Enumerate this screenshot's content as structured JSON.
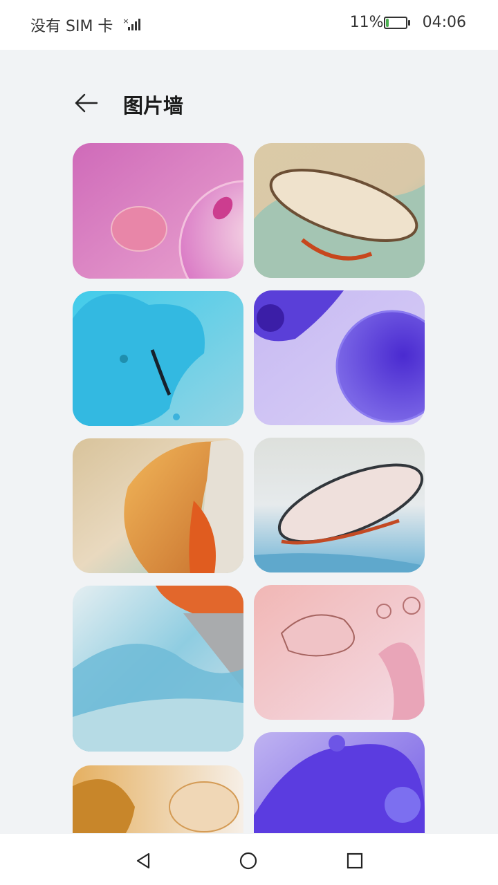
{
  "status_bar": {
    "sim_text": "没有 SIM 卡",
    "signal_x": "×",
    "battery_text": "11%",
    "battery_level": 0.11,
    "time": "04:06"
  },
  "header": {
    "title": "图片墙",
    "back_icon": "arrow-left-icon"
  },
  "gallery": {
    "images": [
      {
        "column": "left",
        "desc_icon": "image",
        "colors": [
          "#d36cc0",
          "#e7a7d5"
        ]
      },
      {
        "column": "right",
        "desc_icon": "image",
        "colors": [
          "#d6c7a3",
          "#a7c4b4"
        ]
      },
      {
        "column": "left",
        "desc_icon": "image",
        "colors": [
          "#3fc7e8",
          "#93d6e6"
        ]
      },
      {
        "column": "right",
        "desc_icon": "image",
        "colors": [
          "#6b4be0",
          "#c9bdf5"
        ]
      },
      {
        "column": "left",
        "desc_icon": "image",
        "colors": [
          "#e0a247",
          "#a9cfc6"
        ]
      },
      {
        "column": "right",
        "desc_icon": "image",
        "colors": [
          "#dde2e5",
          "#6db1d3"
        ]
      },
      {
        "column": "left",
        "desc_icon": "image",
        "colors": [
          "#8cc9dc",
          "#d8e5ea"
        ]
      },
      {
        "column": "right",
        "desc_icon": "image",
        "colors": [
          "#f2b9b6",
          "#f0d6e2"
        ]
      },
      {
        "column": "left",
        "desc_icon": "image",
        "colors": [
          "#d6a155",
          "#f4ede4"
        ]
      },
      {
        "column": "right",
        "desc_icon": "image",
        "colors": [
          "#5a38e0",
          "#c0b4f2"
        ]
      }
    ]
  },
  "nav_bar": {
    "back": "triangle-back-icon",
    "home": "circle-home-icon",
    "recent": "square-recents-icon"
  }
}
